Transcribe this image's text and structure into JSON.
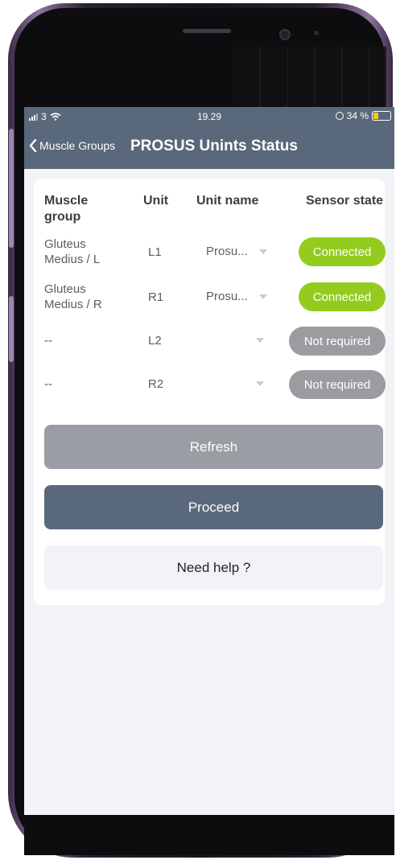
{
  "status_bar": {
    "carrier": "3",
    "time": "19.29",
    "battery_text": "34 %",
    "battery_color": "#f4d10b"
  },
  "nav": {
    "back_label": "Muscle Groups",
    "title": "PROSUS Unints Status"
  },
  "table": {
    "headers": {
      "muscle_group": "Muscle group",
      "unit": "Unit",
      "unit_name": "Unit name",
      "sensor_state": "Sensor state"
    },
    "rows": [
      {
        "muscle_group": "Gluteus Medius / L",
        "unit": "L1",
        "unit_name": "Prosu...",
        "sensor_state": "Connected",
        "state_type": "connected"
      },
      {
        "muscle_group": "Gluteus Medius / R",
        "unit": "R1",
        "unit_name": "Prosu...",
        "sensor_state": "Connected",
        "state_type": "connected"
      },
      {
        "muscle_group": "--",
        "unit": "L2",
        "unit_name": "",
        "sensor_state": "Not required",
        "state_type": "not-required"
      },
      {
        "muscle_group": "--",
        "unit": "R2",
        "unit_name": "",
        "sensor_state": "Not required",
        "state_type": "not-required"
      }
    ]
  },
  "buttons": {
    "refresh": "Refresh",
    "proceed": "Proceed",
    "help": "Need help ?"
  },
  "colors": {
    "header": "#59687a",
    "connected": "#93cc1e",
    "not_required": "#9a9ca0"
  }
}
